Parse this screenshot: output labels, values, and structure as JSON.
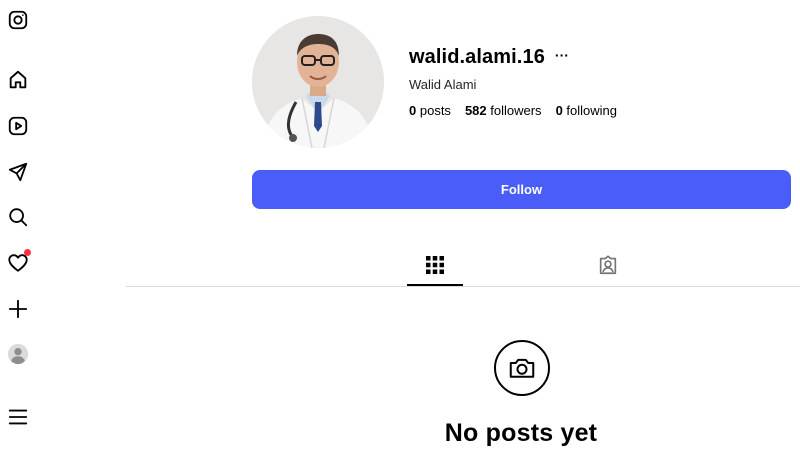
{
  "sidebar": {
    "items": [
      {
        "name": "instagram-logo-icon"
      },
      {
        "name": "home-icon"
      },
      {
        "name": "reels-icon"
      },
      {
        "name": "messages-icon"
      },
      {
        "name": "search-icon"
      },
      {
        "name": "notifications-icon",
        "badge": true
      },
      {
        "name": "create-icon"
      },
      {
        "name": "profile-icon"
      },
      {
        "name": "menu-icon"
      }
    ],
    "notification_color": "#ff3040"
  },
  "profile": {
    "username": "walid.alami.16",
    "more_label": "···",
    "full_name": "Walid Alami",
    "stats": {
      "posts_count": "0",
      "posts_label": "posts",
      "followers_count": "582",
      "followers_label": "followers",
      "following_count": "0",
      "following_label": "following"
    },
    "follow_label": "Follow",
    "follow_color": "#4a5df9"
  },
  "tabs": [
    {
      "name": "posts-grid-icon",
      "active": true
    },
    {
      "name": "tagged-icon",
      "active": false
    }
  ],
  "empty_state": {
    "title": "No posts yet",
    "icon": "camera-icon"
  }
}
